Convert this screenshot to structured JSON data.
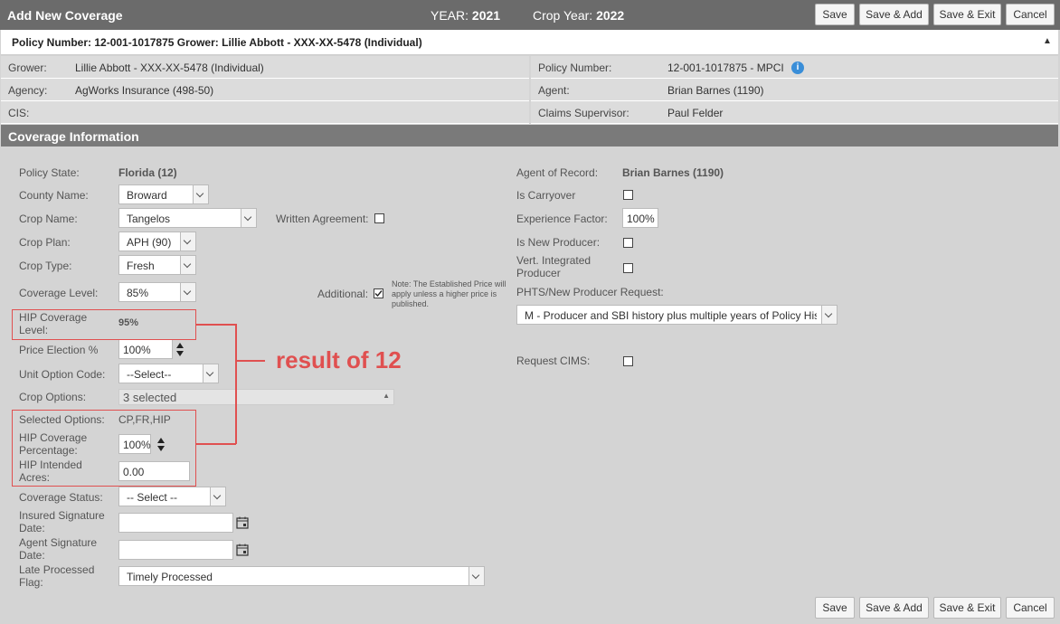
{
  "window": {
    "title": "Add New Coverage",
    "year_label": "YEAR:",
    "year_value": "2021",
    "crop_year_label": "Crop Year:",
    "crop_year_value": "2022"
  },
  "toolbar": {
    "save": "Save",
    "save_add": "Save & Add",
    "save_exit": "Save & Exit",
    "cancel": "Cancel"
  },
  "policy_bar": {
    "text": "Policy Number: 12-001-1017875 Grower: Lillie Abbott - XXX-XX-5478 (Individual)",
    "caret": "▲"
  },
  "info": {
    "grower_label": "Grower:",
    "grower_value": "Lillie Abbott - XXX-XX-5478 (Individual)",
    "agency_label": "Agency:",
    "agency_value": "AgWorks Insurance (498-50)",
    "cis_label": "CIS:",
    "policy_label": "Policy Number:",
    "policy_value": "12-001-1017875 - MPCI",
    "agent_label": "Agent:",
    "agent_value": "Brian Barnes (1190)",
    "claims_label": "Claims Supervisor:",
    "claims_value": "Paul Felder"
  },
  "section_title": "Coverage Information",
  "form": {
    "policy_state_label": "Policy State:",
    "policy_state_value": "Florida (12)",
    "county_label": "County Name:",
    "county_value": "Broward",
    "crop_name_label": "Crop Name:",
    "crop_name_value": "Tangelos",
    "written_agreement_label": "Written Agreement:",
    "crop_plan_label": "Crop Plan:",
    "crop_plan_value": "APH (90)",
    "crop_type_label": "Crop Type:",
    "crop_type_value": "Fresh",
    "coverage_level_label": "Coverage Level:",
    "coverage_level_value": "85%",
    "additional_label": "Additional:",
    "note": "Note: The Established Price will apply unless a higher price is published.",
    "hip_cov_level_label": "HIP Coverage Level:",
    "hip_cov_level_value": "95%",
    "price_election_label": "Price Election %",
    "price_election_value": "100%",
    "unit_option_label": "Unit Option Code:",
    "unit_option_value": "--Select--",
    "crop_options_label": "Crop Options:",
    "crop_options_value": "3 selected",
    "selected_options_label": "Selected Options:",
    "selected_options_value": "CP,FR,HIP",
    "hip_cov_pct_label": "HIP Coverage Percentage:",
    "hip_cov_pct_value": "100%",
    "hip_acres_label": "HIP Intended Acres:",
    "hip_acres_value": "0.00",
    "coverage_status_label": "Coverage Status:",
    "coverage_status_value": "-- Select --",
    "insured_sig_label": "Insured Signature Date:",
    "agent_sig_label": "Agent Signature Date:",
    "late_processed_label": "Late Processed Flag:",
    "late_processed_value": "Timely Processed",
    "agent_of_record_label": "Agent of Record:",
    "agent_of_record_value": "Brian Barnes (1190)",
    "carryover_label": "Is Carryover",
    "experience_label": "Experience Factor:",
    "experience_value": "100%",
    "new_producer_label": "Is New Producer:",
    "vert_integrated_label": "Vert. Integrated Producer",
    "phts_label": "PHTS/New Producer Request:",
    "phts_value": "M - Producer and SBI history plus multiple years of Policy History",
    "request_cims_label": "Request CIMS:"
  },
  "annotation": {
    "text": "result of 12"
  },
  "colors": {
    "titlebar": "#6b6b6b",
    "section": "#7a7a7a",
    "annotation": "#e05050"
  }
}
